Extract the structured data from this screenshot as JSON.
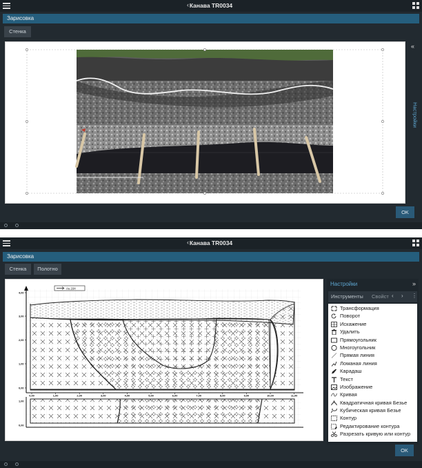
{
  "window": {
    "title": "Канава TR0034"
  },
  "section": {
    "title": "Зарисовка"
  },
  "top_view": {
    "tabs": [
      "Стенка"
    ]
  },
  "bottom_view": {
    "tabs": [
      "Стенка",
      "Полотно"
    ]
  },
  "ok_label": "OK",
  "side_panel": {
    "collapsed_label": "Настройки"
  },
  "settings_panel": {
    "title": "Настройки",
    "tabs": [
      "Инструменты",
      "Свойст"
    ],
    "tools": [
      {
        "label": "Трансформация",
        "icon": "transform-icon"
      },
      {
        "label": "Поворот",
        "icon": "rotate-icon"
      },
      {
        "label": "Искажение",
        "icon": "distort-icon"
      },
      {
        "label": "Удалить",
        "icon": "trash-icon"
      },
      {
        "label": "Прямоугольник",
        "icon": "rectangle-icon"
      },
      {
        "label": "Многоугольник",
        "icon": "polygon-icon"
      },
      {
        "label": "Прямая линия",
        "icon": "line-icon"
      },
      {
        "label": "Ломаная линия",
        "icon": "polyline-icon"
      },
      {
        "label": "Карадаш",
        "icon": "pencil-icon"
      },
      {
        "label": "Текст",
        "icon": "text-icon"
      },
      {
        "label": "Изображение",
        "icon": "image-icon"
      },
      {
        "label": "Кривая",
        "icon": "curve-icon"
      },
      {
        "label": "Квадратичная кривая Безье",
        "icon": "quadratic-bezier-icon"
      },
      {
        "label": "Кубическая кривая Безье",
        "icon": "cubic-bezier-icon"
      },
      {
        "label": "Контур",
        "icon": "contour-icon"
      },
      {
        "label": "Редактирование контура",
        "icon": "edit-contour-icon"
      },
      {
        "label": "Разрезать кривую или контур",
        "icon": "scissors-icon"
      }
    ]
  },
  "drawing": {
    "legend": "As.164",
    "y_ticks": [
      "4,00",
      "3,00",
      "2,00",
      "1,00",
      "0,00"
    ],
    "x_ticks": [
      "0,00",
      "1,00",
      "2,00",
      "3,00",
      "4,00",
      "5,00",
      "6,00",
      "7,00",
      "8,00",
      "9,00",
      "10,00",
      "11,00"
    ],
    "y_ticks_lower": [
      "1,00",
      "0,00"
    ]
  },
  "colors": {
    "app_bg": "#222a30",
    "topbar": "#1b2227",
    "header": "#255e7d",
    "accent": "#5fa8d3",
    "ok_button": "#2a5a78"
  }
}
